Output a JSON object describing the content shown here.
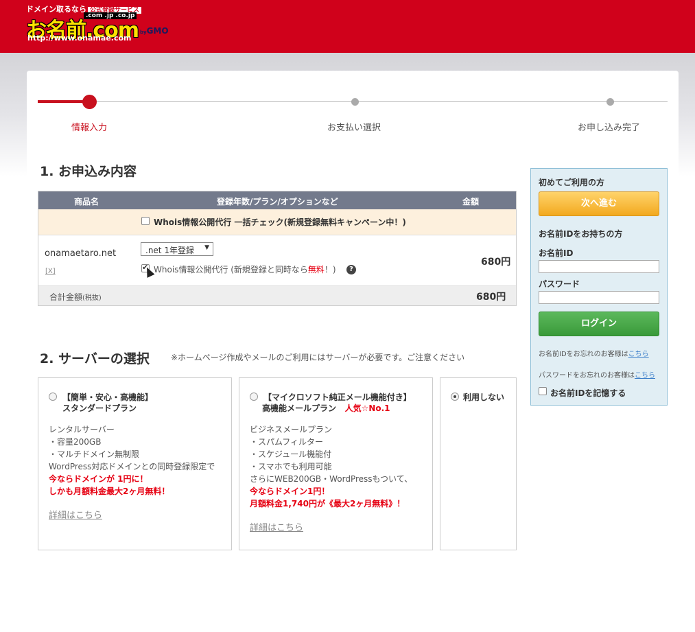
{
  "header": {
    "logo": {
      "tagline": "ドメイン取るなら",
      "tagline_box": "公式登録サービス",
      "tlds": ".com .jp .co.jp",
      "brand": "お名前.com",
      "url": "http://www.onamae.com",
      "gmo_by": "by",
      "gmo": "GMO"
    },
    "brand_color": "#d0011b"
  },
  "progress": {
    "steps": [
      {
        "label": "情報入力",
        "active": true
      },
      {
        "label": "お支払い選択",
        "active": false
      },
      {
        "label": "お申し込み完了",
        "active": false
      }
    ],
    "accent_color": "#c8101e"
  },
  "section1": {
    "title": "1. お申込み内容",
    "table": {
      "headers": [
        "商品名",
        "登録年数/プラン/オプションなど",
        "金額"
      ],
      "promo_check_label": "Whois情報公開代行 一括チェック(新規登録無料キャンペーン中！)",
      "item": {
        "domain": "onamaetaro.net",
        "remove": "[X]",
        "plan_select": ".net 1年登録",
        "whois_label": "Whois情報公開代行 (新規登録と同時なら",
        "whois_free": "無料",
        "whois_end": "！)",
        "help": "?",
        "price": "680円"
      },
      "total_label": "合計金額",
      "total_tax": "(税抜)",
      "total_price": "680円"
    }
  },
  "section2": {
    "title": "2. サーバーの選択",
    "note": "※ホームページ作成やメールのご利用にはサーバーが必要です。ご注意ください",
    "plans": [
      {
        "title1": "【簡単・安心・高機能】",
        "title2": "スタンダードプラン",
        "lines": [
          "レンタルサーバー",
          "・容量200GB",
          "・マルチドメイン無制限",
          "WordPress対応ドメインとの同時登録限定で"
        ],
        "red_lines": [
          "今ならドメインが 1円に！",
          "しかも月額料金最大2ヶ月無料！"
        ],
        "link": "詳細はこちら"
      },
      {
        "title1": "【マイクロソフト純正メール機能付き】",
        "title2": "高機能メールプラン",
        "title2_red": "人気☆No.1",
        "lines": [
          "ビジネスメールプラン",
          "・スパムフィルター",
          "・スケジュール機能付",
          "・スマホでも利用可能",
          "さらにWEB200GB・WordPressもついて、"
        ],
        "red_lines": [
          "今ならドメイン1円！",
          "月額料金1,740円が《最大2ヶ月無料》！"
        ],
        "link": "詳細はこちら"
      },
      {
        "title1": "利用しない"
      }
    ]
  },
  "login": {
    "first_time": "初めてご利用の方",
    "next_button": "次へ進む",
    "have_id": "お名前IDをお持ちの方",
    "id_label": "お名前ID",
    "password_label": "パスワード",
    "login_button": "ログイン",
    "forgot_id": "お名前IDをお忘れのお客様は",
    "forgot_pw": "パスワードをお忘れのお客様は",
    "here": "こちら",
    "remember": "お名前IDを記憶する"
  }
}
